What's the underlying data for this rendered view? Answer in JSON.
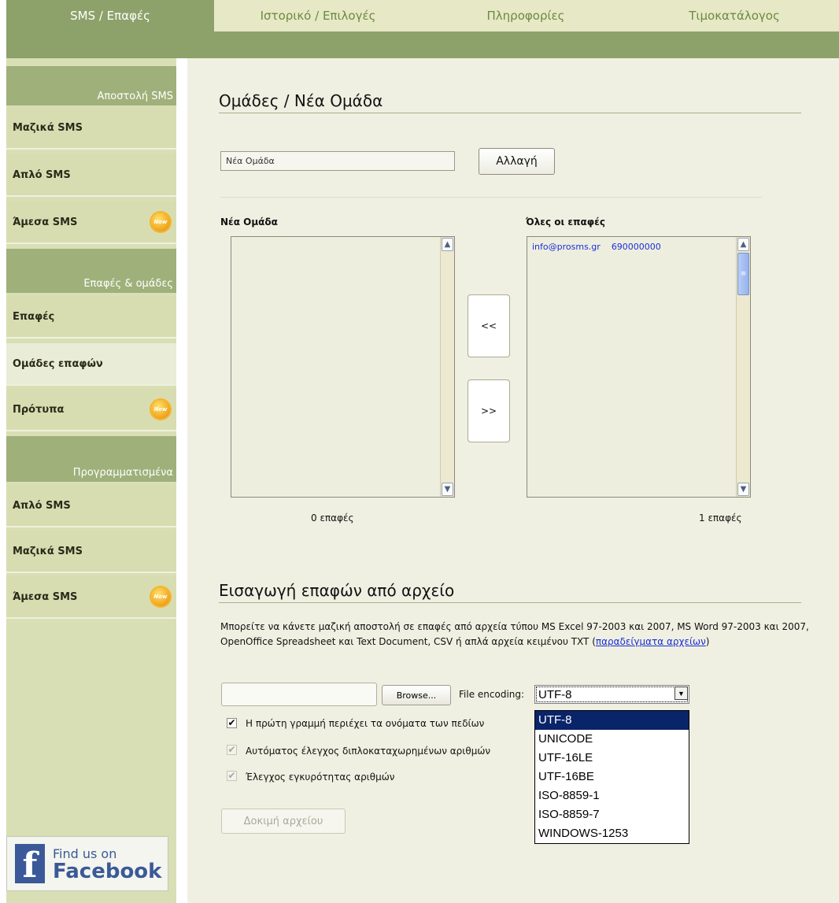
{
  "nav": {
    "tabs": [
      {
        "label": "SMS / Επαφές",
        "active": true
      },
      {
        "label": "Ιστορικό / Επιλογές",
        "active": false
      },
      {
        "label": "Πληροφορίες",
        "active": false
      },
      {
        "label": "Τιμοκατάλογος",
        "active": false
      }
    ]
  },
  "sidebar": {
    "section1": "Αποστολή SMS",
    "section2": "Επαφές & ομάδες",
    "section3": "Προγραμματισμένα",
    "items": [
      {
        "label": "Μαζικά SMS"
      },
      {
        "label": "Απλό SMS"
      },
      {
        "label": "Άμεσα SMS",
        "badge": "New"
      },
      {
        "label": "Επαφές"
      },
      {
        "label": "Ομάδες επαφών",
        "selected": true
      },
      {
        "label": "Πρότυπα",
        "badge": "New"
      },
      {
        "label": "Απλό SMS"
      },
      {
        "label": "Μαζικά SMS"
      },
      {
        "label": "Άμεσα SMS",
        "badge": "New"
      }
    ],
    "facebook": {
      "line1": "Find us on",
      "line2": "Facebook",
      "logo": "f"
    }
  },
  "groups": {
    "title": "Ομάδες / Νέα Ομάδα",
    "name_value": "Νέα Ομάδα",
    "change_button": "Αλλαγή",
    "left_list_title": "Νέα Ομάδα",
    "right_list_title": "Όλες οι επαφές",
    "right_list_rows": [
      {
        "email": "info@prosms.gr",
        "phone": "690000000"
      }
    ],
    "move_left": "<<",
    "move_right": ">>",
    "left_count": "0 επαφές",
    "right_count": "1 επαφές"
  },
  "import": {
    "title": "Εισαγωγή επαφών από αρχείο",
    "description": "Μπορείτε να κάνετε μαζική αποστολή σε επαφές από αρχεία τύπου MS Excel 97-2003 και 2007, MS Word 97-2003 και 2007, OpenOffice Spreadsheet και Text Document, CSV ή απλά αρχεία κειμένου TXT (",
    "examples_link": "παραδείγματα αρχείων",
    "description_end": ")",
    "browse_button": "Browse...",
    "encoding_label": "File encoding:",
    "encoding_selected": "UTF-8",
    "encoding_options": [
      "UTF-8",
      "UNICODE",
      "UTF-16LE",
      "UTF-16BE",
      "ISO-8859-1",
      "ISO-8859-7",
      "WINDOWS-1253"
    ],
    "checkbox1": "Η πρώτη γραμμή περιέχει τα ονόματα των πεδίων",
    "checkbox2": "Αυτόματος έλεγχος διπλοκαταχωρημένων αριθμών",
    "checkbox3": "Έλεγχος εγκυρότητας αριθμών",
    "test_button": "Δοκιμή αρχείου"
  },
  "icons": {
    "new_badge": "new-badge-icon",
    "scroll_up": "▲",
    "scroll_down": "▼",
    "dropdown_arrow": "▼",
    "check": "✔"
  }
}
